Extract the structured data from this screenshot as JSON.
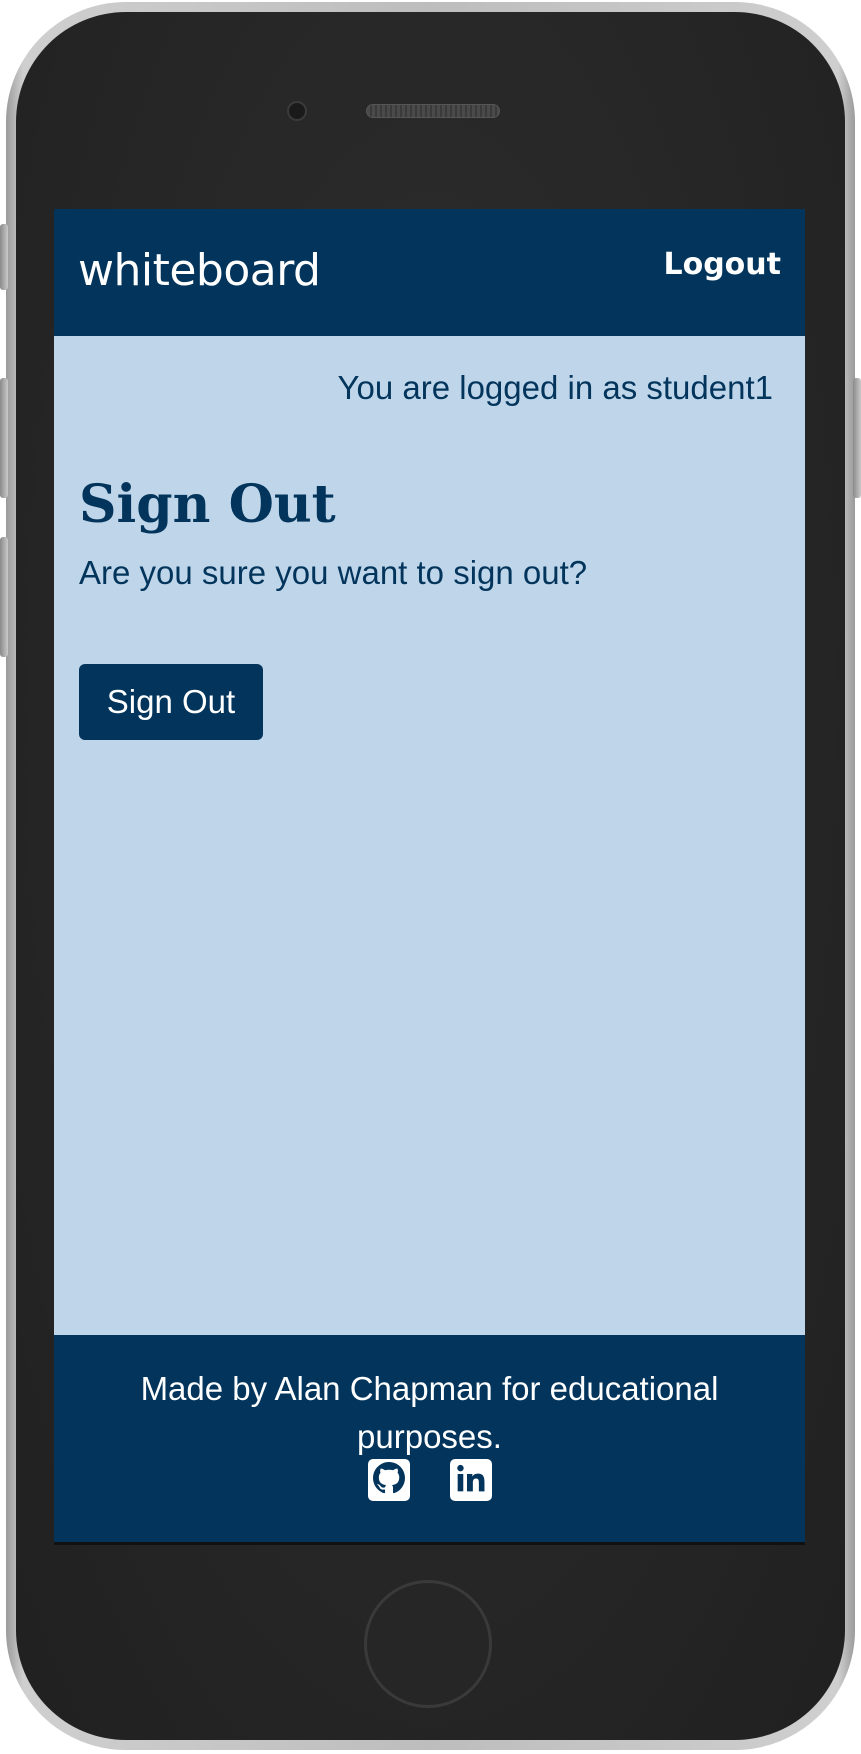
{
  "navbar": {
    "brand": "whiteboard",
    "logout_label": "Logout"
  },
  "status": {
    "logged_in_text": "You are logged in as student1"
  },
  "main": {
    "title": "Sign Out",
    "question": "Are you sure you want to sign out?",
    "signout_button_label": "Sign Out"
  },
  "footer": {
    "text": "Made by Alan Chapman for educational purposes.",
    "icons": [
      "github-icon",
      "linkedin-icon"
    ]
  },
  "colors": {
    "primary": "#03355c",
    "background": "#bfd6ea",
    "text_on_primary": "#ffffff"
  }
}
